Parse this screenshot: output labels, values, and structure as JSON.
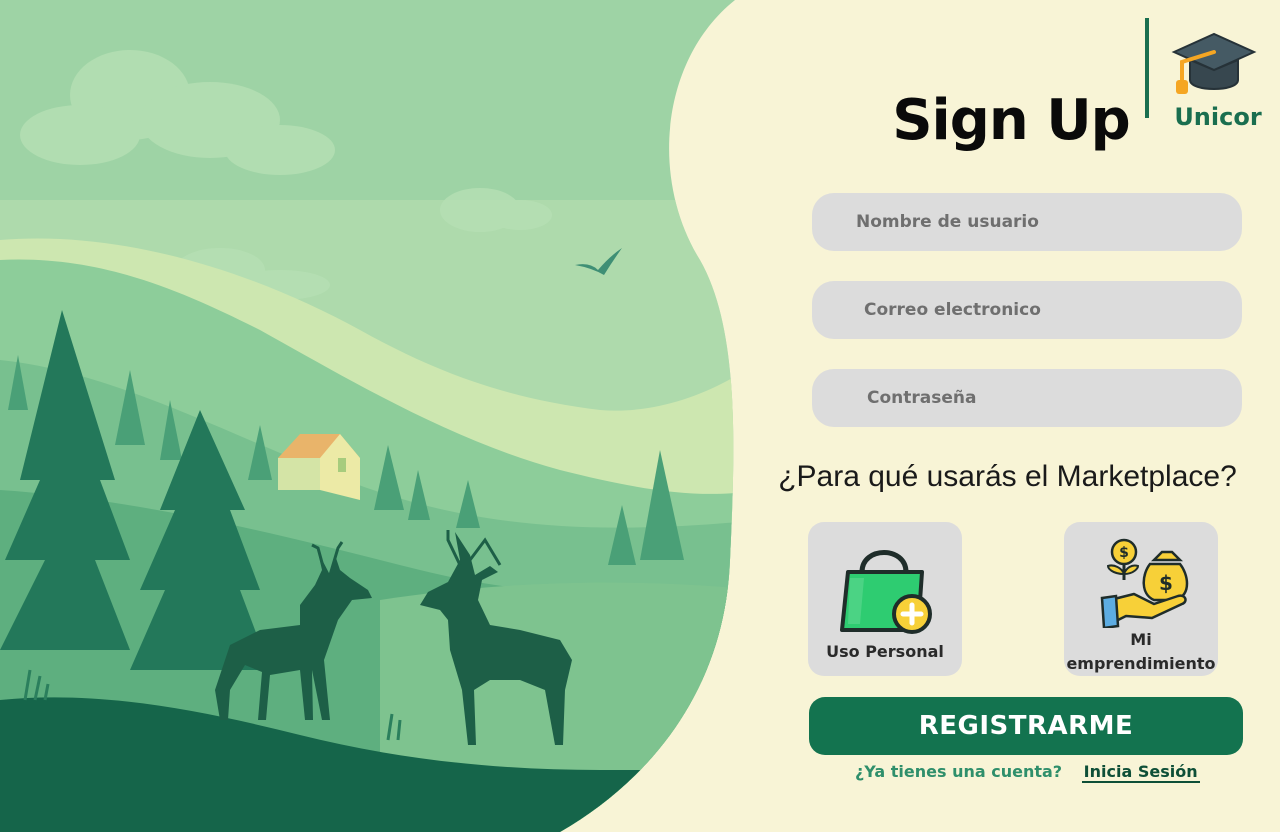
{
  "brand": {
    "name": "Unicor",
    "accent": "#1a6e4f"
  },
  "page": {
    "title": "Sign Up"
  },
  "form": {
    "username_placeholder": "Nombre de usuario",
    "email_placeholder": "Correo electronico",
    "password_placeholder": "Contraseña"
  },
  "purpose": {
    "question": "¿Para qué usarás el Marketplace?",
    "options": [
      {
        "label": "Uso Personal",
        "icon": "shopping-bag-plus-icon"
      },
      {
        "label_line1": "Mi",
        "label_line2": "emprendimiento",
        "icon": "money-growth-hand-icon"
      }
    ]
  },
  "actions": {
    "register_label": "REGISTRARME",
    "button_color": "#13734f"
  },
  "footer": {
    "question": "¿Ya tienes una cuenta?",
    "login_link": "Inicia Sesión"
  },
  "background_color": "#f8f4d6"
}
